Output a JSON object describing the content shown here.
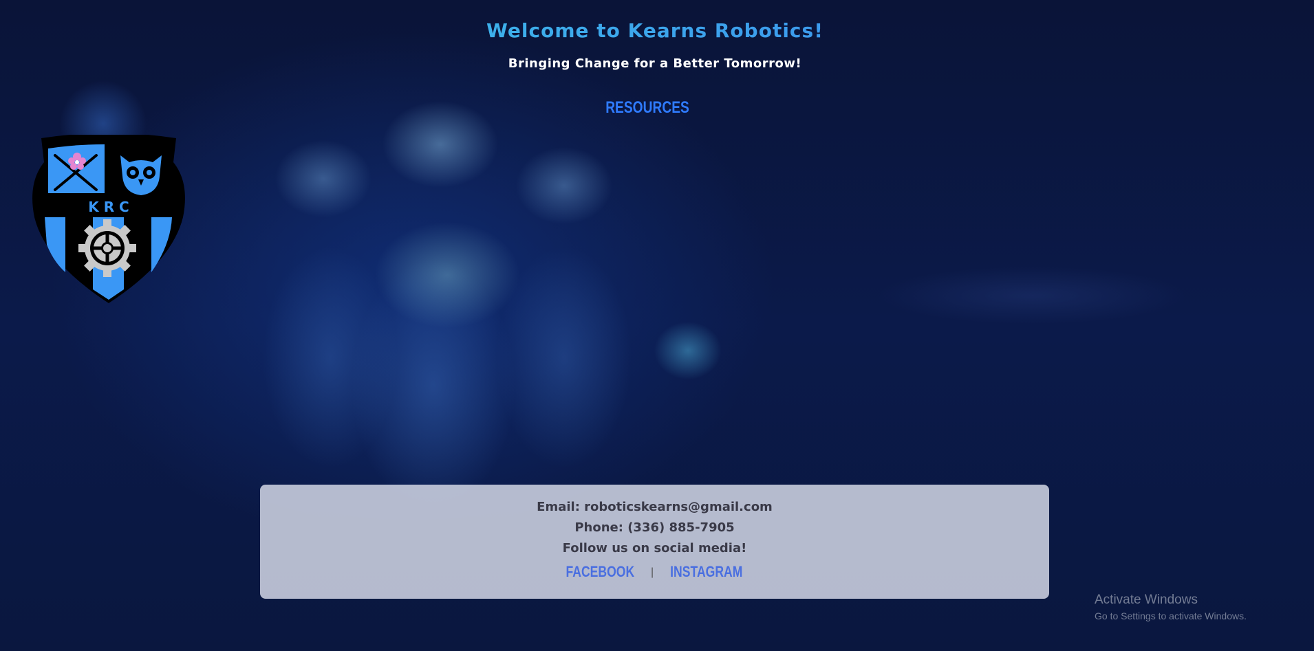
{
  "header": {
    "title": "Welcome to Kearns Robotics!",
    "subtitle": "Bringing Change for a Better Tomorrow!",
    "nav_link": "RESOURCES"
  },
  "logo": {
    "text": "K R C",
    "icon": "krc-crest-logo",
    "colors": {
      "primary": "#3a97f5",
      "outline": "#000000",
      "gear": "#c9c9c9"
    }
  },
  "footer": {
    "email": "Email: roboticskearns@gmail.com",
    "phone": "Phone: (336) 885-7905",
    "follow": "Follow us on social media!",
    "facebook": "FACEBOOK",
    "separator": "|",
    "instagram": "INSTAGRAM"
  },
  "watermark": {
    "title": "Activate Windows",
    "subtitle": "Go to Settings to activate Windows."
  },
  "colors": {
    "title_gradient_start": "#3fd0e8",
    "title_gradient_end": "#3a7bf0",
    "link": "#2f7bff",
    "footer_link": "#4a6fe0",
    "background": "#0a1235"
  }
}
